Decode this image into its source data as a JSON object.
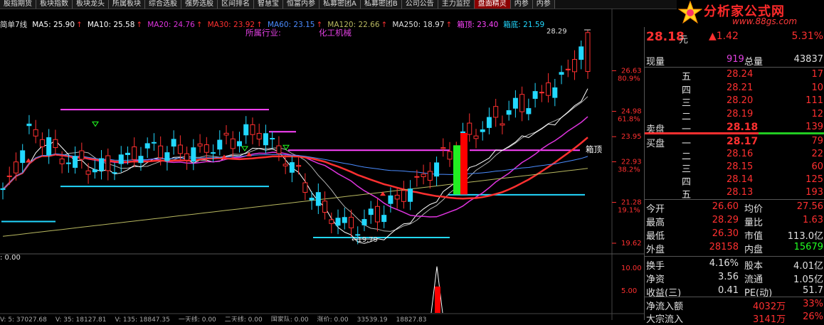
{
  "topbar": {
    "tabs": [
      "股指期货",
      "板块指数",
      "板块龙头",
      "所属板块",
      "综合选股",
      "强势选股",
      "区间排名",
      "智慧宝",
      "恒富内参",
      "私募密团A",
      "私募密团B",
      "公司公告",
      "主力监控",
      "盘面精灵",
      "内参",
      "内参"
    ],
    "active_index": 13
  },
  "logo": {
    "brand": "分析家公式网",
    "url": "www.88gs.com"
  },
  "ma_line": [
    {
      "label": "简单7线",
      "color": "#e0e0e0",
      "arrow": ""
    },
    {
      "label": "MA5: 25.90",
      "color": "#ffffff",
      "arrow": "↑"
    },
    {
      "label": "MA10: 25.58",
      "color": "#ffffff",
      "arrow": "↑"
    },
    {
      "label": "MA20: 24.76",
      "color": "#dd33dd",
      "arrow": "↑"
    },
    {
      "label": "MA30: 23.92",
      "color": "#ff3030",
      "arrow": "↑"
    },
    {
      "label": "MA60: 23.15",
      "color": "#4a8cff",
      "arrow": "↑"
    },
    {
      "label": "MA120: 22.66",
      "color": "#b8b860",
      "arrow": "↑"
    },
    {
      "label": "MA250: 18.97",
      "color": "#e0e0e0",
      "arrow": "↑"
    },
    {
      "label": "箱顶: 23.40",
      "color": "#ff44ff",
      "arrow": ""
    },
    {
      "label": "箱底: 21.59",
      "color": "#22d8ff",
      "arrow": ""
    }
  ],
  "overlays": {
    "industry_label": "所属行业:",
    "industry_value": "化工机械",
    "box_top_label": "箱顶",
    "high_marker": "28.29",
    "low_marker": "19.79",
    "indicator_label": ": 0.00"
  },
  "price_axis": [
    {
      "value": "26.63",
      "pct": "80.9%"
    },
    {
      "value": "24.98",
      "pct": "61.8%"
    },
    {
      "value": "23.95",
      "pct": ""
    },
    {
      "value": "22.93",
      "pct": "38.2%"
    },
    {
      "value": "21.28",
      "pct": "19.1%"
    },
    {
      "value": "19.62",
      "pct": ""
    }
  ],
  "indicator_axis": [
    "10.00",
    "5.00"
  ],
  "bottom_strip": [
    "V: 5: 37027.68",
    "V: 35: 18127.81",
    "V: 135: 18847.35",
    "一天线: 0.00",
    "二天线: 0.00",
    "国家队: 0.00",
    "涨价: 0.00",
    "33539.19",
    "18827.83"
  ],
  "chart_data": {
    "type": "line",
    "title": "",
    "ylim": [
      19.62,
      28.29
    ],
    "series": [
      {
        "name": "MA5",
        "color": "#ffffff"
      },
      {
        "name": "MA10",
        "color": "#ffffff"
      },
      {
        "name": "MA20",
        "color": "#dd33dd"
      },
      {
        "name": "MA30",
        "color": "#ff3030"
      },
      {
        "name": "MA60",
        "color": "#4a8cff"
      },
      {
        "name": "MA120",
        "color": "#b8b860"
      },
      {
        "name": "箱顶",
        "color": "#ff44ff"
      },
      {
        "name": "箱底",
        "color": "#22d8ff"
      }
    ],
    "ma_last": {
      "MA5": 25.9,
      "MA10": 25.58,
      "MA20": 24.76,
      "MA30": 23.92,
      "MA60": 23.15,
      "MA120": 22.66,
      "MA250": 18.97
    },
    "box": {
      "top": 23.4,
      "bottom": 21.59
    },
    "high": 28.29,
    "low": 19.79,
    "close": 28.18
  },
  "quote": {
    "price": "28.18",
    "unit": "元",
    "change": "▲1.42",
    "change_pct": "5.31%",
    "xianliang_label": "现量",
    "xianliang": "919",
    "zongliang_label": "总量",
    "zongliang": "43837",
    "sell_label": "卖盘",
    "buy_label": "买盘",
    "sell": [
      {
        "level": "五",
        "price": "28.24",
        "vol": "17"
      },
      {
        "level": "四",
        "price": "28.21",
        "vol": "10"
      },
      {
        "level": "三",
        "price": "28.20",
        "vol": "111"
      },
      {
        "level": "二",
        "price": "28.19",
        "vol": "12"
      },
      {
        "level": "一",
        "price": "28.18",
        "vol": "139"
      }
    ],
    "buy": [
      {
        "level": "一",
        "price": "28.17",
        "vol": "79"
      },
      {
        "level": "二",
        "price": "28.16",
        "vol": "22"
      },
      {
        "level": "三",
        "price": "28.15",
        "vol": "60"
      },
      {
        "level": "四",
        "price": "28.14",
        "vol": "125"
      },
      {
        "level": "五",
        "price": "28.13",
        "vol": "193"
      }
    ],
    "stats": [
      [
        {
          "label": "今开",
          "value": "26.60",
          "color": "#ff3030"
        },
        {
          "label": "均价",
          "value": "27.56",
          "color": "#ff3030"
        }
      ],
      [
        {
          "label": "最高",
          "value": "28.29",
          "color": "#ff3030"
        },
        {
          "label": "量比",
          "value": "1.63",
          "color": "#ff3030"
        }
      ],
      [
        {
          "label": "最低",
          "value": "26.30",
          "color": "#ff3030"
        },
        {
          "label": "市值",
          "value": "113.0亿",
          "color": "#e0e0e0"
        }
      ],
      [
        {
          "label": "外盘",
          "value": "28158",
          "color": "#ff3030"
        },
        {
          "label": "内盘",
          "value": "15679",
          "color": "#22ff22"
        }
      ]
    ],
    "stats2": [
      [
        {
          "label": "换手",
          "value": "4.16%",
          "color": "#e0e0e0"
        },
        {
          "label": "股本",
          "value": "4.01亿",
          "color": "#e0e0e0"
        }
      ],
      [
        {
          "label": "净资",
          "value": "3.56",
          "color": "#e0e0e0"
        },
        {
          "label": "流通",
          "value": "1.05亿",
          "color": "#e0e0e0"
        }
      ],
      [
        {
          "label": "收益(三)",
          "value": "0.41",
          "color": "#e0e0e0"
        },
        {
          "label": "PE(动)",
          "value": "51.7",
          "color": "#e0e0e0"
        }
      ]
    ],
    "netflow_label": "净流入额",
    "netflow": "4032万",
    "netflow_pct": "33%",
    "block_label": "大宗流入",
    "block": "3141万",
    "block_pct": "26%"
  }
}
